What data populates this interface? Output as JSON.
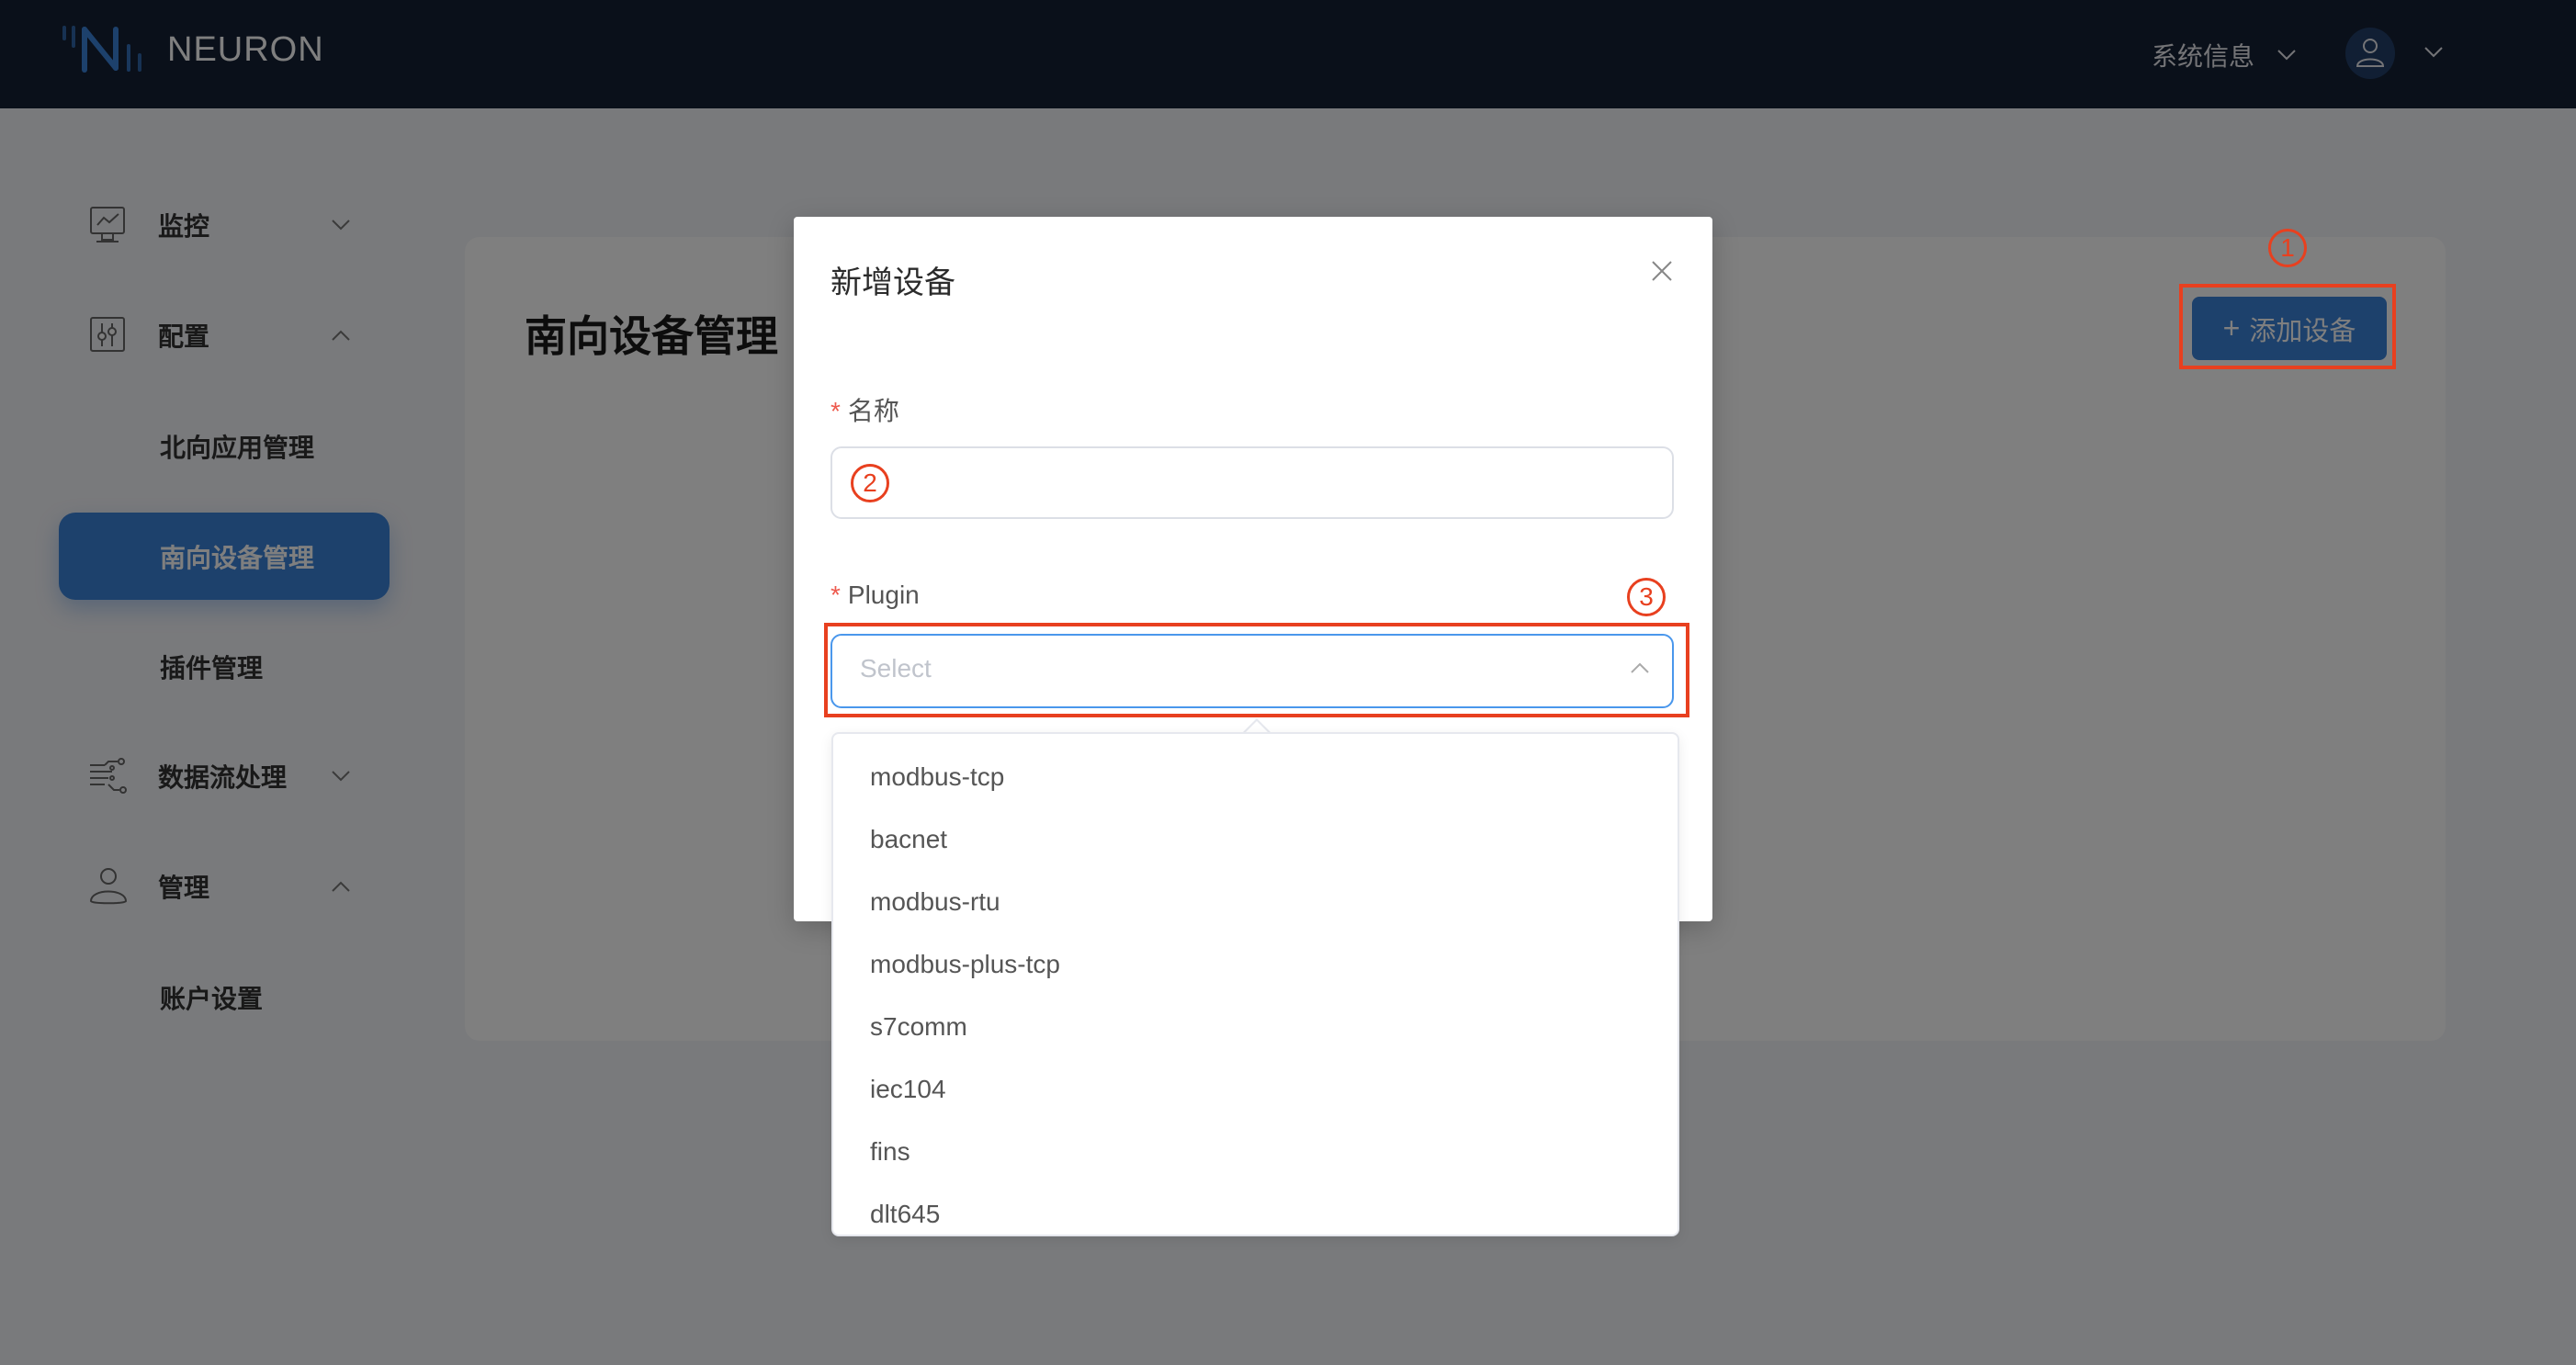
{
  "header": {
    "brand": "NEURON",
    "system_info_label": "系统信息",
    "colors": {
      "bg": "#142035",
      "accent": "#3b82d9"
    }
  },
  "sidebar": {
    "groups": [
      {
        "label": "监控",
        "icon": "monitor-chart-icon",
        "expanded": false,
        "items": []
      },
      {
        "label": "配置",
        "icon": "sliders-icon",
        "expanded": true,
        "items": [
          {
            "label": "北向应用管理",
            "active": false
          },
          {
            "label": "南向设备管理",
            "active": true
          },
          {
            "label": "插件管理",
            "active": false
          }
        ]
      },
      {
        "label": "数据流处理",
        "icon": "data-flow-icon",
        "expanded": false,
        "items": []
      },
      {
        "label": "管理",
        "icon": "user-icon",
        "expanded": true,
        "items": [
          {
            "label": "账户设置",
            "active": false
          }
        ]
      }
    ]
  },
  "main": {
    "page_title": "南向设备管理",
    "add_button_label": "添加设备",
    "add_button_icon": "plus-icon"
  },
  "annotations": [
    "1",
    "2",
    "3"
  ],
  "modal": {
    "title": "新增设备",
    "close_icon": "close-icon",
    "fields": {
      "name": {
        "label": "名称",
        "required": true,
        "value": "",
        "placeholder": ""
      },
      "plugin": {
        "label": "Plugin",
        "required": true,
        "value": "",
        "placeholder": "Select",
        "open": true
      }
    }
  },
  "plugin_options": [
    "modbus-tcp",
    "bacnet",
    "modbus-rtu",
    "modbus-plus-tcp",
    "s7comm",
    "iec104",
    "fins",
    "dlt645"
  ]
}
